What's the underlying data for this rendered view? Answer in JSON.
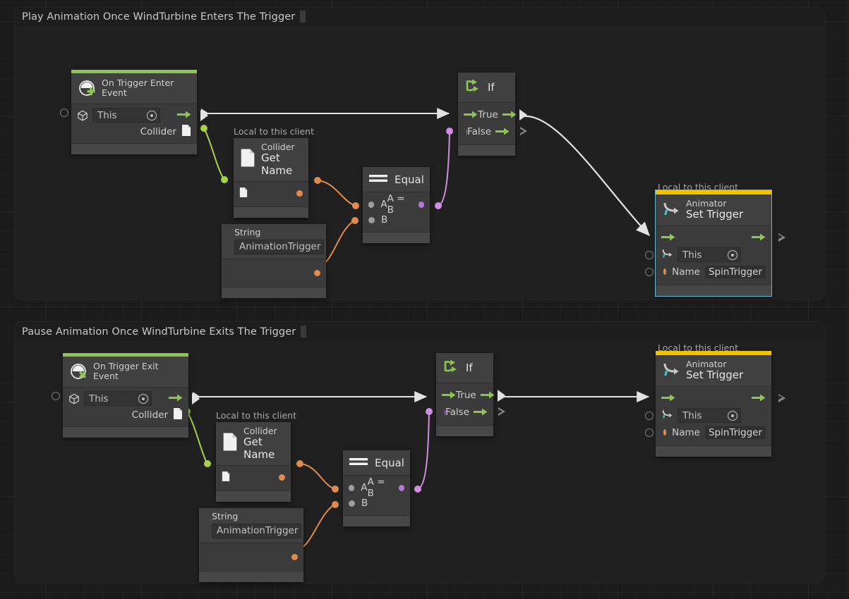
{
  "canvas": {
    "background": "#1b1b1b",
    "grid": true
  },
  "groups": [
    {
      "id": "group-enter",
      "title": "Play Animation Once WindTurbine Enters The Trigger"
    },
    {
      "id": "group-exit",
      "title": "Pause Animation Once WindTurbine Exits The Trigger"
    }
  ],
  "labels": {
    "local_to_client": "Local to this client"
  },
  "colors": {
    "event_accent": "#8ec552",
    "selected_accent": "#f2c200",
    "selection_border": "#63b7d8",
    "flow_wire": "#e2e2e2",
    "string_wire": "#e08b4e",
    "bool_wire": "#b07ad4",
    "object_wire": "#a8d24a",
    "node_body": "#3b3b3b",
    "node_title": "#404040",
    "node_footer": "#474747"
  },
  "nodes": {
    "on_trigger_enter": {
      "icon": "trigger-enter-icon",
      "title_sub": "On Trigger Enter",
      "title_main": "Event",
      "target_value": "This",
      "output_label": "Collider"
    },
    "on_trigger_exit": {
      "icon": "trigger-exit-icon",
      "title_sub": "On Trigger Exit",
      "title_main": "Event",
      "target_value": "This",
      "output_label": "Collider"
    },
    "collider_get_name_1": {
      "icon": "file-icon",
      "title_sub": "Collider",
      "title_main": "Get Name",
      "local_label": "Local to this client"
    },
    "collider_get_name_2": {
      "icon": "file-icon",
      "title_sub": "Collider",
      "title_main": "Get Name",
      "local_label": "Local to this client"
    },
    "string_1": {
      "title": "String",
      "value": "AnimationTrigger"
    },
    "string_2": {
      "title": "String",
      "value": "AnimationTrigger"
    },
    "equal_1": {
      "icon": "equal-icon",
      "title": "Equal",
      "input_a": "A",
      "input_b": "B",
      "output": "A = B"
    },
    "equal_2": {
      "icon": "equal-icon",
      "title": "Equal",
      "input_a": "A",
      "input_b": "B",
      "output": "A = B"
    },
    "if_1": {
      "icon": "branch-icon",
      "title": "If",
      "out_true": "True",
      "out_false": "False"
    },
    "if_2": {
      "icon": "branch-icon",
      "title": "If",
      "out_true": "True",
      "out_false": "False"
    },
    "animator_set_trigger_1": {
      "icon": "animator-icon",
      "title_sub": "Animator",
      "title_main": "Set Trigger",
      "local_label": "Local to this client",
      "target_value": "This",
      "name_label": "Name",
      "name_value": "SpinTrigger",
      "selected": true
    },
    "animator_set_trigger_2": {
      "icon": "animator-icon",
      "title_sub": "Animator",
      "title_main": "Set Trigger",
      "local_label": "Local to this client",
      "target_value": "This",
      "name_label": "Name",
      "name_value": "SpinTrigger",
      "selected": false
    }
  }
}
